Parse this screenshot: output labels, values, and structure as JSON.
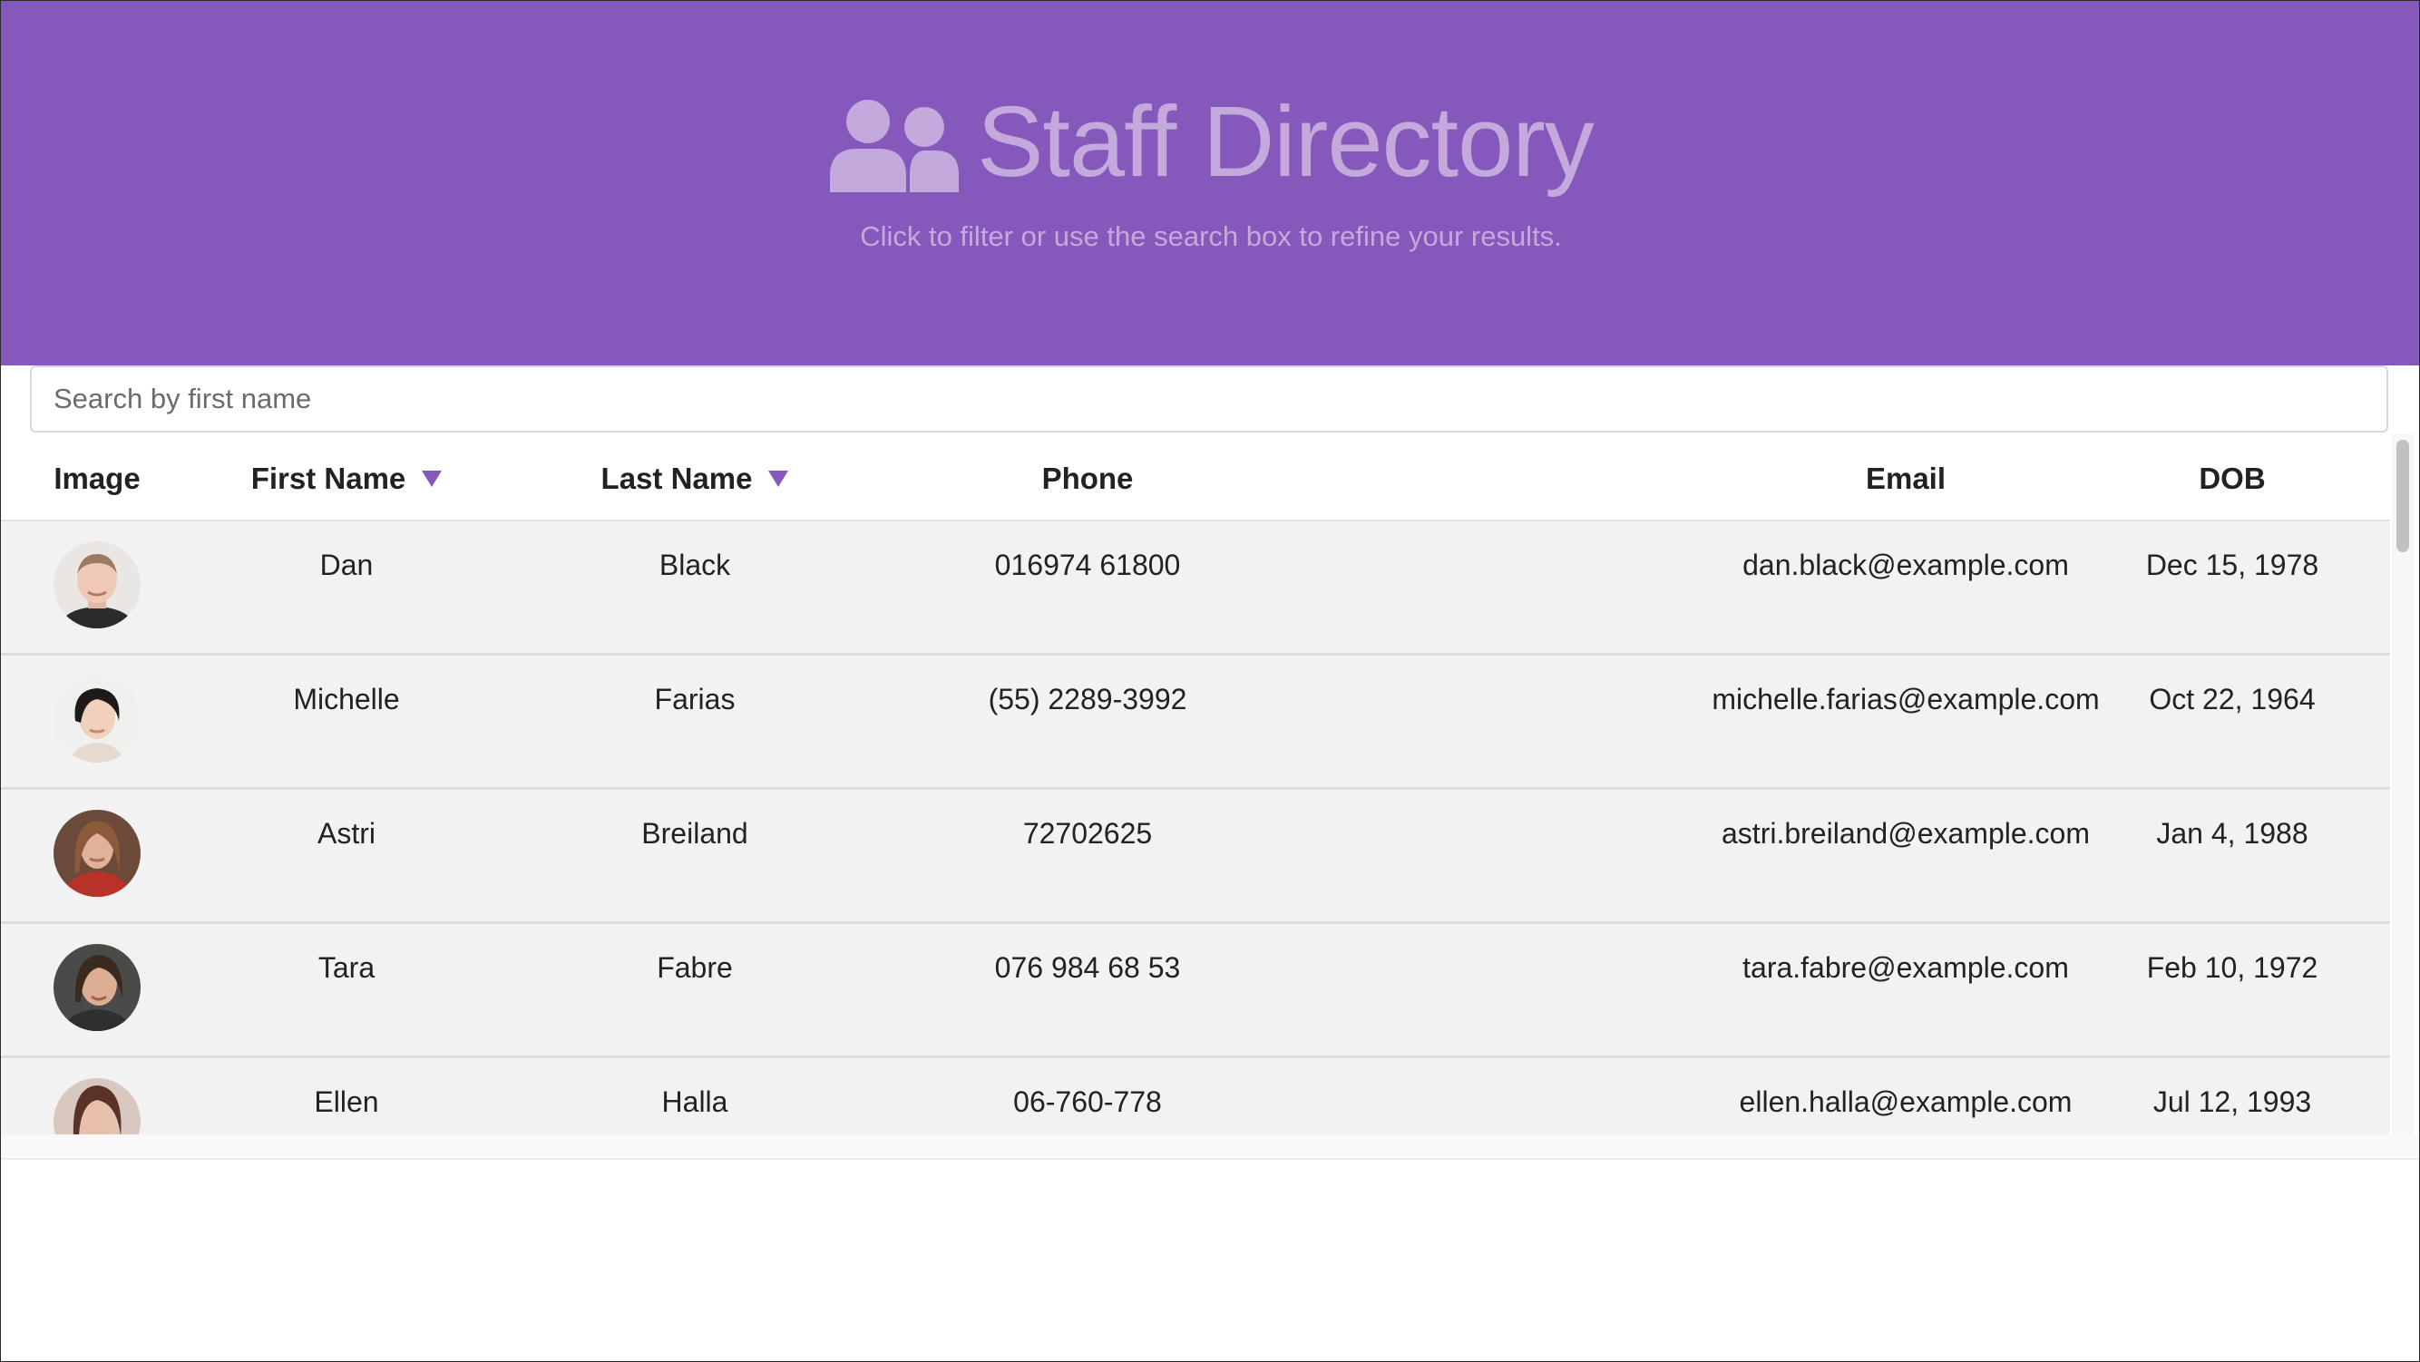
{
  "header": {
    "title": "Staff Directory",
    "subtitle": "Click to filter or use the search box to refine your results.",
    "icon": "users-icon",
    "bg_color": "#8558bb",
    "text_color": "#c3a9dc"
  },
  "search": {
    "placeholder": "Search by first name",
    "value": ""
  },
  "table": {
    "columns": {
      "image": "Image",
      "first_name": "First Name",
      "last_name": "Last Name",
      "phone": "Phone",
      "email": "Email",
      "dob": "DOB"
    },
    "sortable_columns": [
      "First Name",
      "Last Name"
    ],
    "rows": [
      {
        "first": "Dan",
        "last": "Black",
        "phone": "016974 61800",
        "email": "dan.black@example.com",
        "dob": "Dec 15, 1978",
        "avatar": "man-portrait"
      },
      {
        "first": "Michelle",
        "last": "Farias",
        "phone": "(55) 2289-3992",
        "email": "michelle.farias@example.com",
        "dob": "Oct 22, 1964",
        "avatar": "woman-portrait"
      },
      {
        "first": "Astri",
        "last": "Breiland",
        "phone": "72702625",
        "email": "astri.breiland@example.com",
        "dob": "Jan 4, 1988",
        "avatar": "woman-portrait"
      },
      {
        "first": "Tara",
        "last": "Fabre",
        "phone": "076 984 68 53",
        "email": "tara.fabre@example.com",
        "dob": "Feb 10, 1972",
        "avatar": "woman-portrait"
      },
      {
        "first": "Ellen",
        "last": "Halla",
        "phone": "06-760-778",
        "email": "ellen.halla@example.com",
        "dob": "Jul 12, 1993",
        "avatar": "woman-portrait"
      }
    ]
  }
}
